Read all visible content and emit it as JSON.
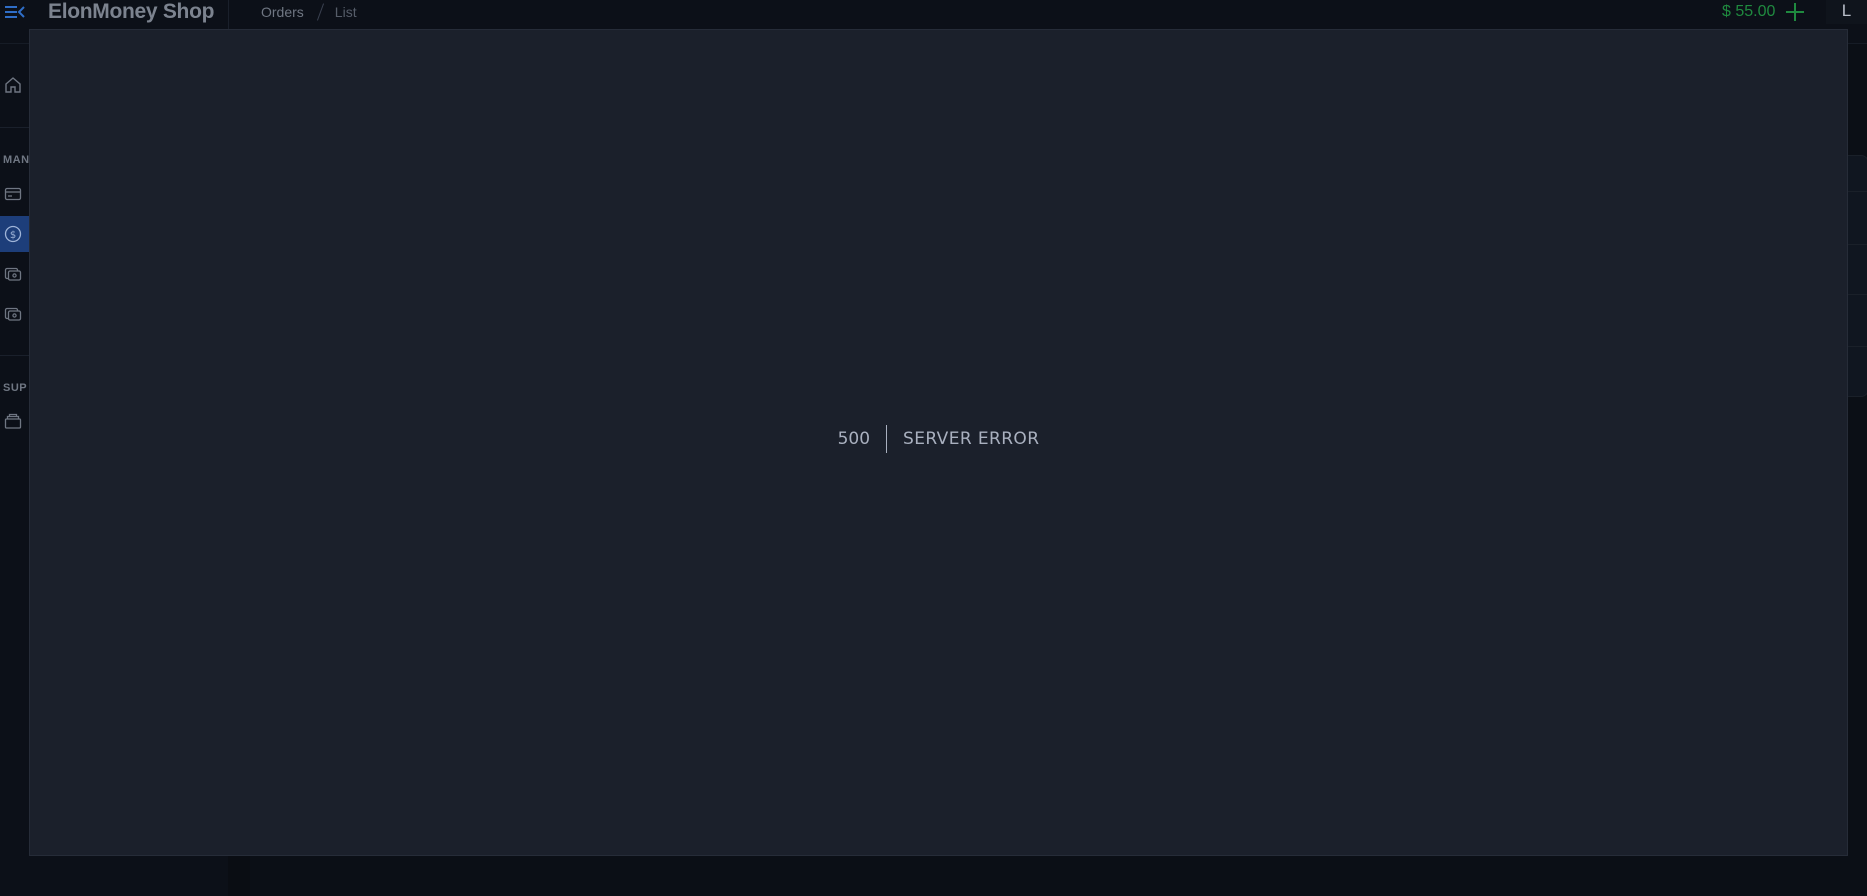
{
  "app": {
    "brand": "ElonMoney Shop"
  },
  "breadcrumb": {
    "section": "Orders",
    "page": "List"
  },
  "header": {
    "balance": "$ 55.00",
    "user_initial": "L",
    "balance_color": "#1f8a3f"
  },
  "sidebar": {
    "sections": [
      "MAN",
      "SUP"
    ],
    "icons": [
      "home-icon",
      "card-icon",
      "dollar-icon",
      "wallet-icon",
      "wallet-alt-icon",
      "box-icon"
    ],
    "active_color": "#1d3e7a"
  },
  "error": {
    "code": "500",
    "message": "SERVER ERROR"
  }
}
